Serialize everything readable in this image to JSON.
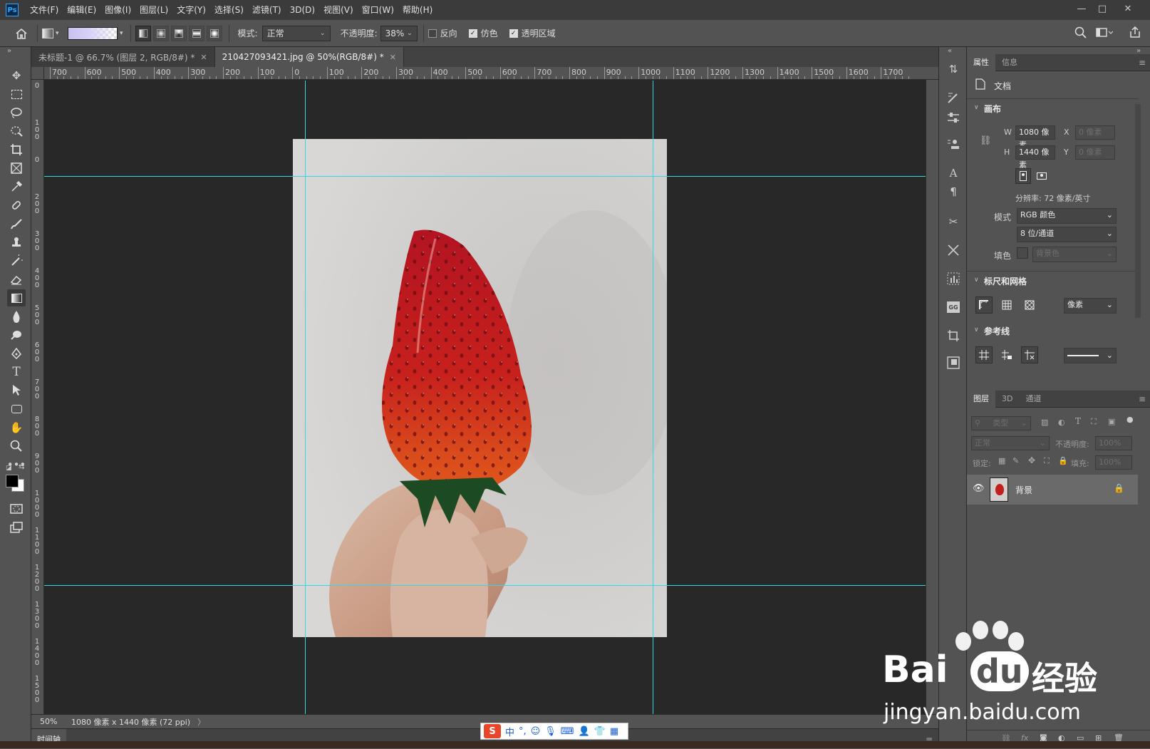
{
  "app": {
    "logo": "Ps",
    "menu": [
      "文件(F)",
      "编辑(E)",
      "图像(I)",
      "图层(L)",
      "文字(Y)",
      "选择(S)",
      "滤镜(T)",
      "3D(D)",
      "视图(V)",
      "窗口(W)",
      "帮助(H)"
    ],
    "window_controls": [
      "—",
      "□",
      "✕"
    ]
  },
  "options": {
    "mode_label": "模式:",
    "mode_value": "正常",
    "opacity_label": "不透明度:",
    "opacity_value": "38%",
    "reverse_label": "反向",
    "reverse_checked": false,
    "dither_label": "仿色",
    "dither_checked": true,
    "transparency_label": "透明区域",
    "transparency_checked": true
  },
  "tabs": [
    {
      "label": "未标题-1 @ 66.7% (图层 2, RGB/8#) *",
      "active": false
    },
    {
      "label": "210427093421.jpg @ 50%(RGB/8#) *",
      "active": true
    }
  ],
  "ruler": {
    "h_labels": [
      "700",
      "600",
      "500",
      "400",
      "300",
      "200",
      "100",
      "0",
      "100",
      "200",
      "300",
      "400",
      "500",
      "600",
      "700",
      "800",
      "900",
      "1000",
      "1100",
      "1200",
      "1300",
      "1400",
      "1500",
      "1600",
      "1700"
    ],
    "v_labels": [
      "0",
      "100",
      "0",
      "200",
      "300",
      "400",
      "500",
      "600",
      "700",
      "800",
      "900",
      "1000",
      "1100",
      "1200",
      "1300",
      "1400",
      "1500"
    ]
  },
  "status": {
    "zoom": "50%",
    "doc_info": "1080 像素 x 1440 像素 (72 ppi)",
    "arrow": "〉"
  },
  "timeline_label": "时间轴",
  "properties": {
    "tab_active": "属性",
    "tab_other": "信息",
    "doc_label": "文档",
    "canvas_title": "画布",
    "w_label": "W",
    "w_value": "1080 像素",
    "h_label": "H",
    "h_value": "1440 像素",
    "x_label": "X",
    "x_value": "0 像素",
    "y_label": "Y",
    "y_value": "0 像素",
    "resolution": "分辨率: 72 像素/英寸",
    "mode_label": "模式",
    "mode_value": "RGB 颜色",
    "depth_value": "8 位/通道",
    "fill_label": "填色",
    "fill_value": "背景色",
    "rulers_title": "标尺和网格",
    "units_value": "像素",
    "guides_title": "参考线"
  },
  "layers": {
    "tab_active": "图层",
    "tab_3d": "3D",
    "tab_channels": "通道",
    "filter_label": "类型",
    "blend_value": "正常",
    "opacity_label": "不透明度:",
    "opacity_value": "100%",
    "lock_label": "锁定:",
    "fill_label": "填充:",
    "fill_value": "100%",
    "items": [
      {
        "name": "背景",
        "visible": true,
        "locked": true
      }
    ]
  },
  "ime": {
    "logo": "S",
    "mode": "中",
    "punct": "°,"
  },
  "watermark": {
    "brand": "Bai",
    "brand2": "du",
    "cn": "经验",
    "url": "jingyan.baidu.com"
  },
  "colors": {
    "guide": "#36d6e7",
    "accent": "#31a8ff"
  }
}
